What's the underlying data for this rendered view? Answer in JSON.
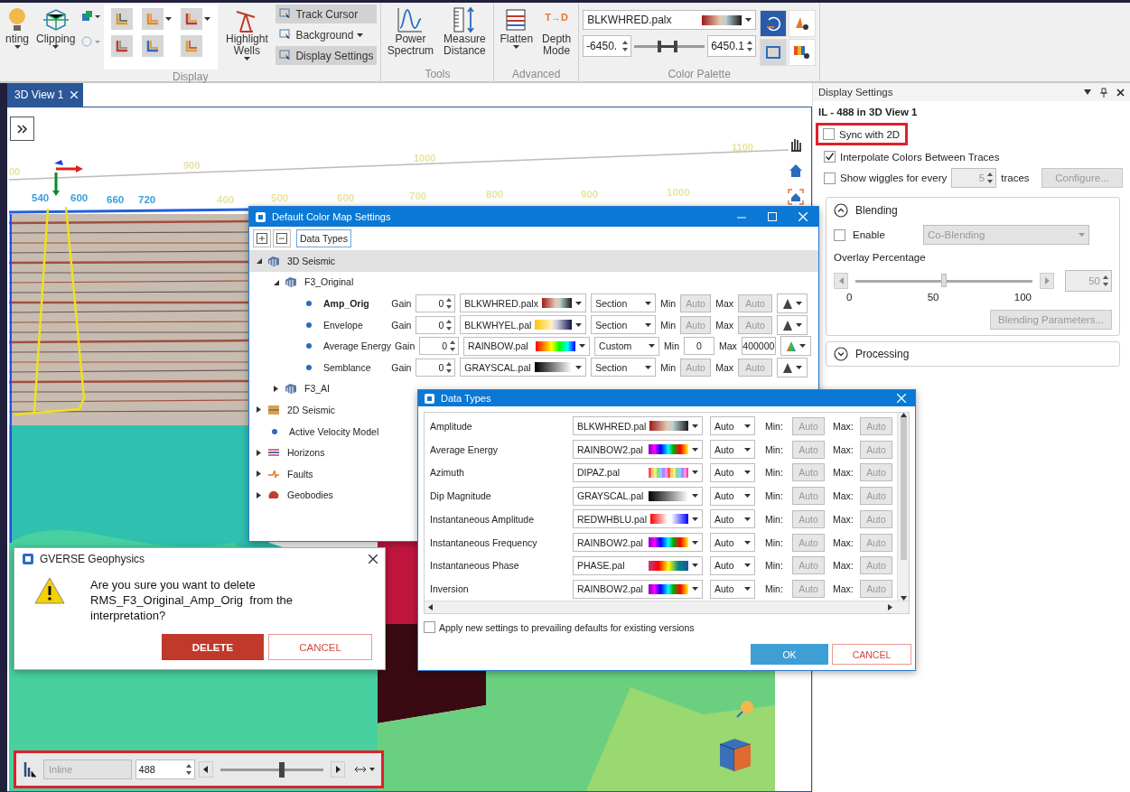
{
  "ribbon": {
    "lead_buttons": [
      {
        "label": "nting"
      },
      {
        "label": "Clipping"
      }
    ],
    "display": {
      "title": "Display",
      "highlight_wells": "Highlight Wells",
      "small_buttons": [
        {
          "label": "Track Cursor",
          "selected": true,
          "dropdown": false
        },
        {
          "label": "Background",
          "selected": false,
          "dropdown": true
        },
        {
          "label": "Display Settings",
          "selected": true,
          "dropdown": false
        }
      ]
    },
    "tools": {
      "title": "Tools",
      "buttons": [
        {
          "label": "Power Spectrum"
        },
        {
          "label": "Measure Distance"
        }
      ]
    },
    "advanced": {
      "title": "Advanced",
      "flatten": "Flatten",
      "depth_icon": "T→D",
      "depth_mode": "Depth Mode"
    },
    "palette": {
      "title": "Color Palette",
      "name": "BLKWHRED.palx",
      "kind": "blkwhred",
      "min": "-6450.",
      "max": "6450.1",
      "level": 0.47
    }
  },
  "view": {
    "tab": "3D View 1",
    "upper_labels": [
      "00",
      "900",
      "1000",
      "1100"
    ],
    "lower_labels": [
      {
        "text": "540",
        "kind": "inline"
      },
      {
        "text": "600",
        "kind": "inline"
      },
      {
        "text": "660",
        "kind": "inline"
      },
      {
        "text": "720",
        "kind": "inline"
      },
      {
        "text": "400",
        "kind": "crossline"
      },
      {
        "text": "500",
        "kind": "crossline"
      },
      {
        "text": "600",
        "kind": "crossline"
      },
      {
        "text": "700",
        "kind": "crossline"
      },
      {
        "text": "800",
        "kind": "crossline"
      },
      {
        "text": "900",
        "kind": "crossline"
      },
      {
        "text": "1000",
        "kind": "crossline"
      }
    ]
  },
  "bottom_bar": {
    "mode": "Inline",
    "value": "488",
    "level": 0.6
  },
  "display_settings": {
    "title": "Display Settings",
    "subtitle": "IL - 488 in 3D View 1",
    "sync_2d": {
      "label": "Sync with 2D",
      "checked": false
    },
    "interpolate": {
      "label": "Interpolate Colors Between Traces",
      "checked": true
    },
    "wiggles": {
      "label": "Show wiggles for every",
      "checked": false,
      "value": "5",
      "suffix": "traces",
      "button": "Configure..."
    },
    "blending": {
      "title": "Blending",
      "expanded": true,
      "enable": {
        "label": "Enable",
        "checked": false
      },
      "mode": "Co-Blending",
      "overlay_label": "Overlay Percentage",
      "level": 0.5,
      "ticks": [
        "0",
        "50",
        "100"
      ],
      "value": "50",
      "button": "Blending Parameters..."
    },
    "processing": {
      "title": "Processing",
      "expanded": false
    }
  },
  "color_map_dialog": {
    "title": "Default Color Map Settings",
    "toolbar_button": "Data Types",
    "tree": [
      {
        "label": "3D Seismic",
        "kind": "seismic",
        "expanded": true,
        "selected": true,
        "children": [
          {
            "label": "F3_Original",
            "kind": "seismic",
            "expanded": true,
            "selected": false,
            "children": [
              {
                "label": "Amp_Orig",
                "kind": "dot",
                "selected": false,
                "active": true,
                "settings": {
                  "gain_label": "Gain",
                  "gain": "0",
                  "palette": "BLKWHRED.palx",
                  "kind": "blkwhred",
                  "range": "Section",
                  "min_label": "Min",
                  "min": "Auto",
                  "max_label": "Max",
                  "max": "Auto",
                  "limits_disabled": true
                }
              },
              {
                "label": "Envelope",
                "kind": "dot",
                "selected": false,
                "active": false,
                "settings": {
                  "gain_label": "Gain",
                  "gain": "0",
                  "palette": "BLKWHYEL.pal",
                  "kind": "blkwhyel",
                  "range": "Section",
                  "min_label": "Min",
                  "min": "Auto",
                  "max_label": "Max",
                  "max": "Auto",
                  "limits_disabled": true
                }
              },
              {
                "label": "Average Energy",
                "kind": "dot",
                "selected": false,
                "active": false,
                "settings": {
                  "gain_label": "Gain",
                  "gain": "0",
                  "palette": "RAINBOW.pal",
                  "kind": "rainbow",
                  "range": "Custom",
                  "min_label": "Min",
                  "min": "0",
                  "max_label": "Max",
                  "max": "400000",
                  "limits_disabled": false
                }
              },
              {
                "label": "Semblance",
                "kind": "dot",
                "selected": false,
                "active": false,
                "settings": {
                  "gain_label": "Gain",
                  "gain": "0",
                  "palette": "GRAYSCAL.pal",
                  "kind": "grayscal",
                  "range": "Section",
                  "min_label": "Min",
                  "min": "Auto",
                  "max_label": "Max",
                  "max": "Auto",
                  "limits_disabled": true
                }
              }
            ]
          },
          {
            "label": "F3_AI",
            "kind": "seismic",
            "expanded": false,
            "selected": false
          }
        ]
      },
      {
        "label": "2D Seismic",
        "kind": "seismic2d",
        "expanded": false,
        "selected": false
      },
      {
        "label": "Active Velocity Model",
        "kind": "dot",
        "selected": false
      },
      {
        "label": "Horizons",
        "kind": "horizon",
        "expanded": false,
        "selected": false
      },
      {
        "label": "Faults",
        "kind": "fault",
        "expanded": false,
        "selected": false
      },
      {
        "label": "Geobodies",
        "kind": "geobody",
        "expanded": false,
        "selected": false
      }
    ]
  },
  "data_types_dialog": {
    "title": "Data Types",
    "rows": [
      {
        "name": "Amplitude",
        "palette": "BLKWHRED.pal",
        "kind": "blkwhred",
        "range": "Auto",
        "min_label": "Min:",
        "min": "Auto",
        "max_label": "Max:",
        "max": "Auto"
      },
      {
        "name": "Average Energy",
        "palette": "RAINBOW2.pal",
        "kind": "rainbow2",
        "range": "Auto",
        "min_label": "Min:",
        "min": "Auto",
        "max_label": "Max:",
        "max": "Auto"
      },
      {
        "name": "Azimuth",
        "palette": "DIPAZ.pal",
        "kind": "dipaz",
        "range": "Auto",
        "min_label": "Min:",
        "min": "Auto",
        "max_label": "Max:",
        "max": "Auto"
      },
      {
        "name": "Dip Magnitude",
        "palette": "GRAYSCAL.pal",
        "kind": "grayscal",
        "range": "Auto",
        "min_label": "Min:",
        "min": "Auto",
        "max_label": "Max:",
        "max": "Auto"
      },
      {
        "name": "Instantaneous Amplitude",
        "palette": "REDWHBLU.pal",
        "kind": "redwhblu",
        "range": "Auto",
        "min_label": "Min:",
        "min": "Auto",
        "max_label": "Max:",
        "max": "Auto"
      },
      {
        "name": "Instantaneous Frequency",
        "palette": "RAINBOW2.pal",
        "kind": "rainbow2",
        "range": "Auto",
        "min_label": "Min:",
        "min": "Auto",
        "max_label": "Max:",
        "max": "Auto"
      },
      {
        "name": "Instantaneous Phase",
        "palette": "PHASE.pal",
        "kind": "phase",
        "range": "Auto",
        "min_label": "Min:",
        "min": "Auto",
        "max_label": "Max:",
        "max": "Auto"
      },
      {
        "name": "Inversion",
        "palette": "RAINBOW2.pal",
        "kind": "rainbow2",
        "range": "Auto",
        "min_label": "Min:",
        "min": "Auto",
        "max_label": "Max:",
        "max": "Auto"
      }
    ],
    "apply": {
      "label": "Apply new settings to prevailing defaults for existing versions",
      "checked": false
    },
    "ok": "OK",
    "cancel": "CANCEL"
  },
  "confirm_dialog": {
    "title": "GVERSE Geophysics",
    "message": "Are you sure you want to delete RMS_F3_Original_Amp_Orig  from the interpretation?",
    "delete": "DELETE",
    "cancel": "CANCEL"
  }
}
